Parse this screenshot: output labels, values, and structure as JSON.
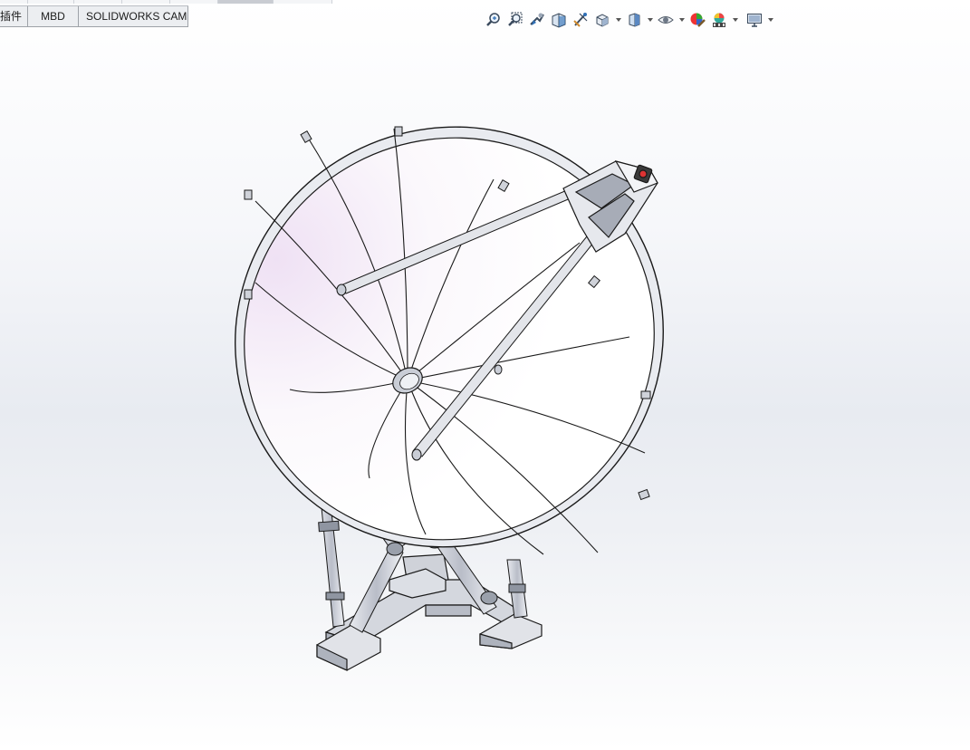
{
  "tabs": [
    {
      "id": "plugins",
      "label": "插件"
    },
    {
      "id": "mbd",
      "label": "MBD"
    },
    {
      "id": "cam",
      "label": "SOLIDWORKS CAM"
    }
  ],
  "heads_up_toolbar": [
    {
      "id": "zoom-to-fit",
      "icon": "zoom-to-fit-icon"
    },
    {
      "id": "zoom-to-area",
      "icon": "zoom-to-area-icon"
    },
    {
      "id": "previous-view",
      "icon": "previous-view-icon"
    },
    {
      "id": "section-view",
      "icon": "section-view-icon"
    },
    {
      "id": "dynamic-annotation",
      "icon": "dynamic-annotation-icon"
    },
    {
      "id": "view-orientation",
      "icon": "view-orientation-icon"
    },
    {
      "id": "display-style",
      "icon": "display-style-icon"
    },
    {
      "id": "hide-show-items",
      "icon": "hide-show-items-icon"
    },
    {
      "id": "edit-appearance",
      "icon": "edit-appearance-icon"
    },
    {
      "id": "apply-scene",
      "icon": "apply-scene-icon"
    },
    {
      "id": "view-settings",
      "icon": "view-settings-icon"
    }
  ],
  "colors": {
    "accent_blue": "#2f6fb6",
    "model_line": "#1a1a1a",
    "dish_tint": "#f4e9f7",
    "metal": "#c9cdd6"
  }
}
